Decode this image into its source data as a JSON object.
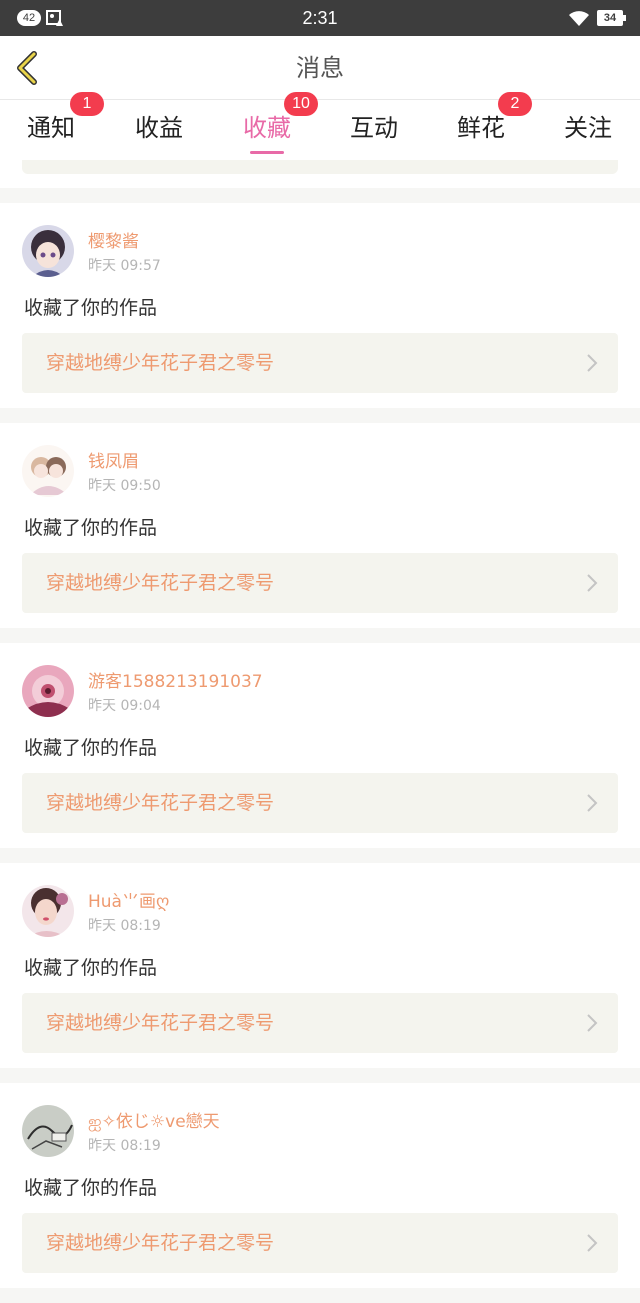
{
  "status_bar": {
    "notif_count": "42",
    "time": "2:31",
    "battery": "34"
  },
  "header": {
    "title": "消息"
  },
  "tabs": [
    {
      "label": "通知",
      "badge": "1"
    },
    {
      "label": "收益",
      "badge": ""
    },
    {
      "label": "收藏",
      "badge": "10",
      "active": true
    },
    {
      "label": "互动",
      "badge": ""
    },
    {
      "label": "鲜花",
      "badge": "2"
    },
    {
      "label": "关注",
      "badge": ""
    }
  ],
  "colors": {
    "accent": "#e86aa7",
    "badge": "#f33c4e",
    "username": "#ee9a70",
    "work_bg": "#f4f4ee"
  },
  "items": [
    {
      "user": "樱黎酱",
      "time": "昨天 09:57",
      "action": "收藏了你的作品",
      "work": "穿越地缚少年花子君之零号",
      "avatar_icon": "avatar-anime-girl"
    },
    {
      "user": "钱凤眉",
      "time": "昨天 09:50",
      "action": "收藏了你的作品",
      "work": "穿越地缚少年花子君之零号",
      "avatar_icon": "avatar-chibi-couple"
    },
    {
      "user": "游客1588213191037",
      "time": "昨天 09:04",
      "action": "收藏了你的作品",
      "work": "穿越地缚少年花子君之零号",
      "avatar_icon": "avatar-pink-hands"
    },
    {
      "user": "Huà⺌画ღ",
      "time": "昨天 08:19",
      "action": "收藏了你的作品",
      "work": "穿越地缚少年花子君之零号",
      "avatar_icon": "avatar-girl-photo"
    },
    {
      "user": "ஐ✧依じ☼ve戀天",
      "time": "昨天 08:19",
      "action": "收藏了你的作品",
      "work": "穿越地缚少年花子君之零号",
      "avatar_icon": "avatar-sketch"
    }
  ]
}
